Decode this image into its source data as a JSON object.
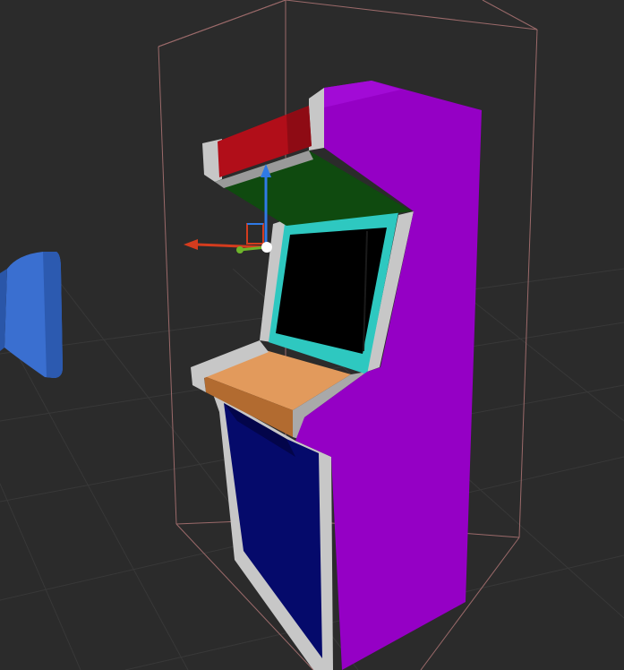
{
  "viewport": {
    "background": "#2b2b2b",
    "grid_color": "#3a3a3a"
  },
  "selection": {
    "bounds_color": "#9b6a6a"
  },
  "gizmo": {
    "x_axis_color": "#d43c1e",
    "y_axis_color": "#6db52b",
    "z_axis_color": "#2f7ae6",
    "pivot_color": "#ffffff"
  },
  "arcade_cabinet": {
    "side_color": "#9500c5",
    "marquee_color": "#b10e19",
    "marquee_underside_color": "#0f4a0f",
    "screen_bezel_color": "#2ec8c0",
    "screen_color": "#000000",
    "control_panel_color": "#e29a5c",
    "lower_panel_color": "#050a6b",
    "trim_color": "#c7c7c7"
  },
  "other_object": {
    "color": "#3a6fd0"
  }
}
